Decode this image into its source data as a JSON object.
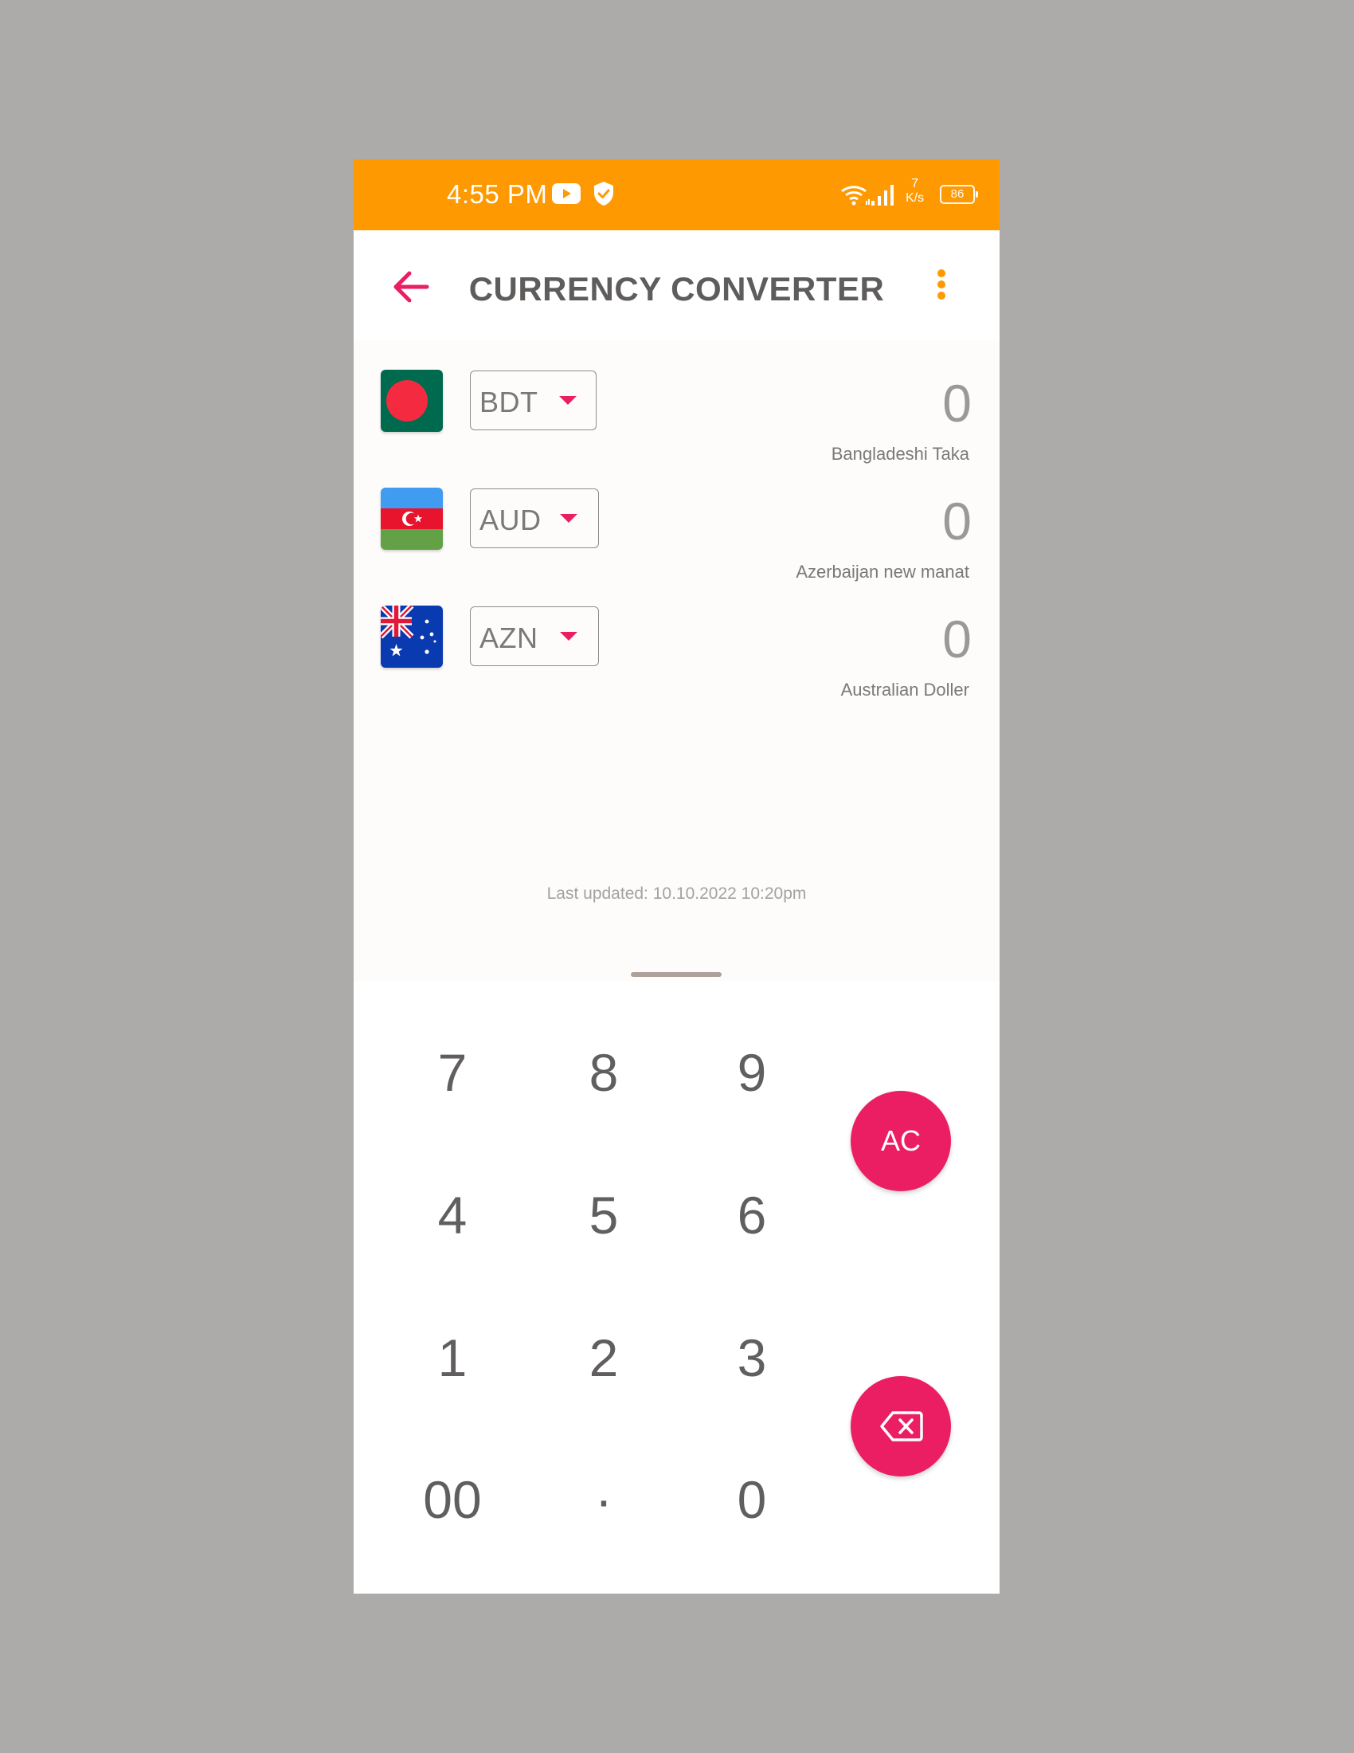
{
  "status_bar": {
    "time": "4:55 PM",
    "speed_value": "7",
    "speed_unit": "K/s",
    "battery": "86",
    "icons": [
      "youtube-icon",
      "shield-check-icon",
      "wifi-icon",
      "signal-icon",
      "battery-icon"
    ]
  },
  "app_bar": {
    "title": "CURRENCY CONVERTER",
    "back_icon": "arrow-left-icon",
    "menu_icon": "more-vertical-icon"
  },
  "currencies": [
    {
      "flag": "bangladesh-flag",
      "code": "BDT",
      "amount": "0",
      "name": "Bangladeshi Taka"
    },
    {
      "flag": "azerbaijan-flag",
      "code": "AUD",
      "amount": "0",
      "name": "Azerbaijan new manat"
    },
    {
      "flag": "australia-flag",
      "code": "AZN",
      "amount": "0",
      "name": "Australian Doller"
    }
  ],
  "last_updated": "Last updated: 10.10.2022 10:20pm",
  "keypad": {
    "keys": [
      [
        "7",
        "8",
        "9"
      ],
      [
        "4",
        "5",
        "6"
      ],
      [
        "1",
        "2",
        "3"
      ],
      [
        "00",
        "·",
        "0"
      ]
    ],
    "clear_label": "AC",
    "backspace_icon": "backspace-icon"
  },
  "colors": {
    "status_bar": "#ff9902",
    "accent": "#eb1e63",
    "menu_dots": "#ff9902",
    "title": "#5f5c5c"
  }
}
